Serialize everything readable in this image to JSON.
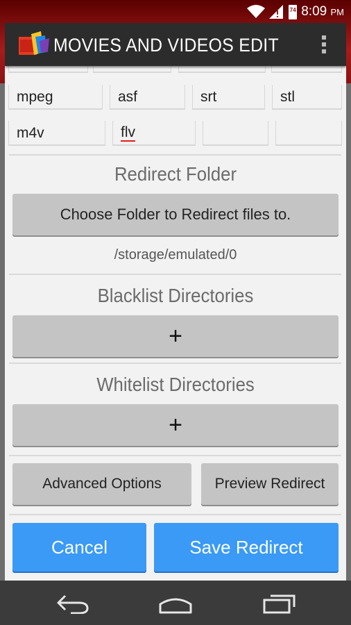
{
  "status_bar": {
    "time": "8:09",
    "ampm": "PM",
    "battery_level": "74"
  },
  "header": {
    "title": "MOVIES AND VIDEOS EDIT",
    "icons": [
      "app-logo-icon",
      "overflow-menu-icon"
    ]
  },
  "extensions": {
    "row1": [
      "mpeg",
      "asf",
      "srt",
      "stl"
    ],
    "row2": [
      "m4v",
      "flv",
      "",
      ""
    ]
  },
  "redirect_folder": {
    "title": "Redirect Folder",
    "button_label": "Choose Folder to Redirect files to.",
    "path": "/storage/emulated/0"
  },
  "blacklist": {
    "title": "Blacklist Directories",
    "add_label": "+"
  },
  "whitelist": {
    "title": "Whitelist Directories",
    "add_label": "+"
  },
  "options": {
    "advanced_label": "Advanced Options",
    "preview_label": "Preview Redirect"
  },
  "actions": {
    "cancel_label": "Cancel",
    "save_label": "Save Redirect"
  },
  "nav_bar": {
    "icons": [
      "back-icon",
      "home-icon",
      "recents-icon"
    ]
  },
  "colors": {
    "accent_blue": "#3a9af5",
    "action_bar": "#2c2c2c",
    "status_bar_red": "#a51c1c",
    "error_underline": "#e21c1c"
  }
}
